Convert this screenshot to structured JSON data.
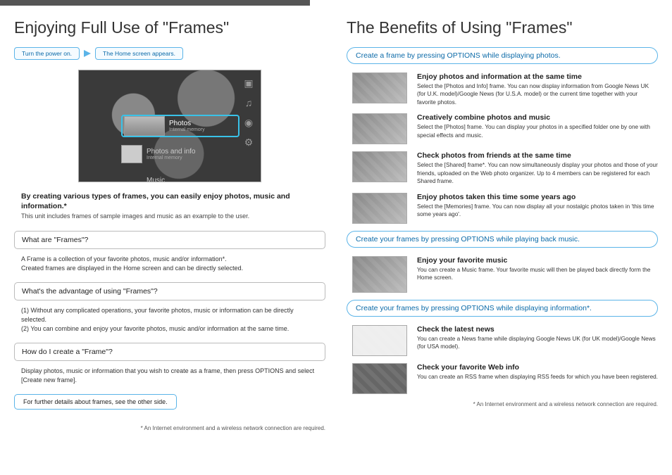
{
  "left": {
    "title": "Enjoying Full Use of \"Frames\"",
    "step1": "Turn the power on.",
    "step2": "The Home screen appears.",
    "scr": {
      "row1_label": "Photos",
      "row1_sub": "Internal memory",
      "row2_label": "Photos and info",
      "row2_sub": "Internal memory",
      "row3_label": "Music"
    },
    "intro_bold": "By creating various types of frames, you can easily enjoy photos, music and information.*",
    "intro_note": "This unit includes frames of sample images and music as an example to the user.",
    "q1": "What are \"Frames\"?",
    "q1_body1": "A Frame is a collection of your favorite photos, music and/or information*.",
    "q1_body2": "Created frames are displayed in the Home screen and can be directly selected.",
    "q2": "What's the advantage of using \"Frames\"?",
    "q2_body1": "(1) Without any complicated operations, your favorite photos, music or information can be directly selected.",
    "q2_body2": "(2) You can combine and enjoy your favorite photos, music and/or information at the same time.",
    "q3": "How do I create a \"Frame\"?",
    "q3_body": "Display photos, music or information that you wish to create as a frame, then press OPTIONS and select [Create new frame].",
    "further": "For further details about frames, see the other side.",
    "footnote": "* An Internet environment and a wireless network connection are required."
  },
  "right": {
    "title": "The Benefits of Using \"Frames\"",
    "rule1": "Create a frame by pressing OPTIONS while displaying photos.",
    "f1_h": "Enjoy photos and information at the same time",
    "f1_p": "Select the [Photos and Info] frame. You can now display information from Google News UK (for U.K. model)/Google News (for U.S.A. model) or the current time together with your favorite photos.",
    "f2_h": "Creatively combine photos and music",
    "f2_p": "Select the [Photos] frame. You can display your photos in a specified folder one by one with special effects and music.",
    "f3_h": "Check photos from friends at the same time",
    "f3_p": "Select the [Shared] frame*. You can now simultaneously display your photos and those of your friends, uploaded on the Web photo organizer. Up to 4 members can be registered for each Shared frame.",
    "f4_h": "Enjoy photos taken this time some years ago",
    "f4_p": "Select the [Memories] frame. You can now display all your nostalgic photos taken in 'this time some years ago'.",
    "rule2": "Create your frames by pressing OPTIONS while playing back music.",
    "f5_h": "Enjoy your favorite music",
    "f5_p": "You can create a Music frame. Your favorite music will then be played back directly form the Home screen.",
    "rule3": "Create your frames by pressing OPTIONS while displaying information*.",
    "f6_h": "Check the latest news",
    "f6_p": "You can create a News frame while displaying Google News UK (for UK model)/Google News (for USA model).",
    "f7_h": "Check your favorite Web info",
    "f7_p": "You can create an RSS frame when displaying RSS feeds for which you have been registered.",
    "footnote": "* An Internet environment and a wireless network connection are required."
  }
}
